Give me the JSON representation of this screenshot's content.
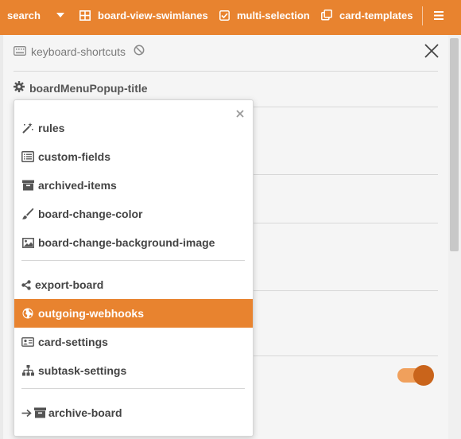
{
  "topbar": {
    "search_label": "search",
    "swimlanes_label": "board-view-swimlanes",
    "multiselection_label": "multi-selection",
    "card_templates_label": "card-templates"
  },
  "sidebar": {
    "keyboard_shortcuts_label": "keyboard-shortcuts",
    "board_menu_title": "boardMenuPopup-title",
    "toggle_on": true
  },
  "popup": {
    "items": [
      {
        "label": "rules",
        "icon": "magic-wand-icon"
      },
      {
        "label": "custom-fields",
        "icon": "list-alt-icon"
      },
      {
        "label": "archived-items",
        "icon": "archive-icon"
      },
      {
        "label": "board-change-color",
        "icon": "paint-brush-icon"
      },
      {
        "label": "board-change-background-image",
        "icon": "image-icon"
      },
      {
        "label": "export-board",
        "icon": "share-alt-icon"
      },
      {
        "label": "outgoing-webhooks",
        "icon": "globe-icon"
      },
      {
        "label": "card-settings",
        "icon": "id-card-icon"
      },
      {
        "label": "subtask-settings",
        "icon": "sitemap-icon"
      },
      {
        "label": "archive-board",
        "icon": "arrow-archive-icon"
      }
    ],
    "active_item": "outgoing-webhooks"
  },
  "colors": {
    "accent": "#e8832f",
    "toggle_track": "#f0a05c",
    "toggle_knob": "#c9641b"
  }
}
